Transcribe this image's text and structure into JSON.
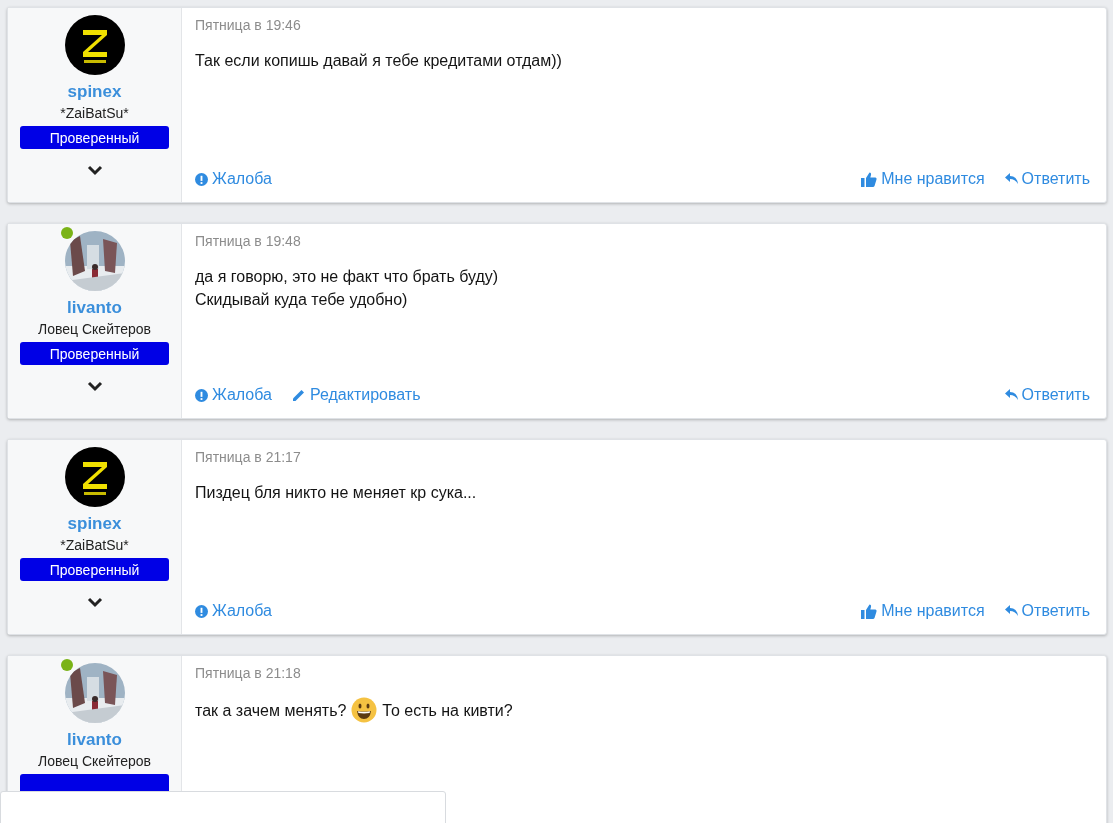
{
  "posts": [
    {
      "author": {
        "name": "spinex",
        "title": "*ZaiBatSu*",
        "avatar": {
          "kind": "logo"
        },
        "online": false,
        "badge": "Проверенный"
      },
      "date": "Пятница в 19:46",
      "body": [
        [
          {
            "kind": "text",
            "text": "Так если копишь давай я тебе кредитами отдам))"
          }
        ]
      ],
      "actions_left": [
        {
          "kind": "report",
          "label": "Жалоба"
        }
      ],
      "actions_right": [
        {
          "kind": "like",
          "label": "Мне нравится"
        },
        {
          "kind": "reply",
          "label": "Ответить"
        }
      ]
    },
    {
      "author": {
        "name": "livanto",
        "title": "Ловец Скейтеров",
        "online": true,
        "badge": "Проверенный"
      },
      "date": "Пятница в 19:48",
      "body": [
        [
          {
            "kind": "text",
            "text": "да я говорю, это не факт что брать буду)"
          }
        ],
        [
          {
            "kind": "text",
            "text": "Скидывай куда тебе удобно)"
          }
        ]
      ],
      "actions_left": [
        {
          "kind": "report",
          "label": "Жалоба"
        },
        {
          "kind": "edit",
          "label": "Редактировать"
        }
      ],
      "actions_right": [
        {
          "kind": "reply",
          "label": "Ответить"
        }
      ]
    },
    {
      "author": {
        "name": "spinex",
        "title": "*ZaiBatSu*",
        "avatar": {
          "kind": "logo"
        },
        "online": false,
        "badge": "Проверенный"
      },
      "date": "Пятница в 21:17",
      "body": [
        [
          {
            "kind": "text",
            "text": "Пиздец бля никто не меняет кр сука..."
          }
        ]
      ],
      "actions_left": [
        {
          "kind": "report",
          "label": "Жалоба"
        }
      ],
      "actions_right": [
        {
          "kind": "like",
          "label": "Мне нравится"
        },
        {
          "kind": "reply",
          "label": "Ответить"
        }
      ]
    },
    {
      "author": {
        "name": "livanto",
        "title": "Ловец Скейтеров",
        "online": true,
        "badge_covered": true
      },
      "date": "Пятница в 21:18",
      "body": [
        [
          {
            "kind": "text",
            "text": "так а зачем менять?"
          },
          {
            "kind": "emoji"
          },
          {
            "kind": "text",
            "text": "То есть на кивти?"
          }
        ]
      ]
    }
  ],
  "popup": {
    "kind": "panel"
  }
}
